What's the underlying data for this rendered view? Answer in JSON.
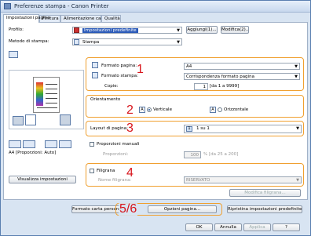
{
  "window": {
    "title": "Preferenze stampa - Canon Printer"
  },
  "tabs": [
    "Impostazioni pagina",
    "Finitura",
    "Alimentazione carta",
    "Qualità"
  ],
  "profile": {
    "label": "Profilo:",
    "value": "Impostazioni predefinite",
    "add": "Aggiungi(1)...",
    "modify": "Modifica(2)..."
  },
  "output": {
    "label": "Metodo di stampa:",
    "value": "Stampa"
  },
  "paper": {
    "size_label": "Formato pagina:",
    "size_value": "A4",
    "output_label": "Formato stampa:",
    "output_value": "Corrispondenza formato pagina",
    "copies_label": "Copie:",
    "copies_value": "1",
    "copies_range": "[da 1 a 9999]"
  },
  "orientation": {
    "label": "Orientamento",
    "portrait": "Verticale",
    "landscape": "Orizzontale"
  },
  "layout": {
    "label": "Layout di pagina:",
    "value": "1 su 1",
    "manual": "Proporzioni manuali",
    "ratio_label": "Proporzioni:",
    "ratio_value": "100",
    "ratio_range": "% [da 25 a 200]"
  },
  "watermark": {
    "label": "Filigrana",
    "name_label": "Nome filigrana:",
    "name_value": "RISERVATO",
    "edit": "Modifica filigrana..."
  },
  "preview": {
    "caption": "A4 [Proporzioni: Auto]",
    "view_settings": "Visualizza impostazioni"
  },
  "buttons": {
    "custom_paper": "Formato carta personalizzato...",
    "page_options": "Opzioni pagina...",
    "restore": "Ripristina impostazioni predefinite",
    "ok": "OK",
    "cancel": "Annulla",
    "apply": "Applica",
    "help": "?"
  },
  "callouts": [
    "1",
    "2",
    "3",
    "4",
    "5/6"
  ]
}
